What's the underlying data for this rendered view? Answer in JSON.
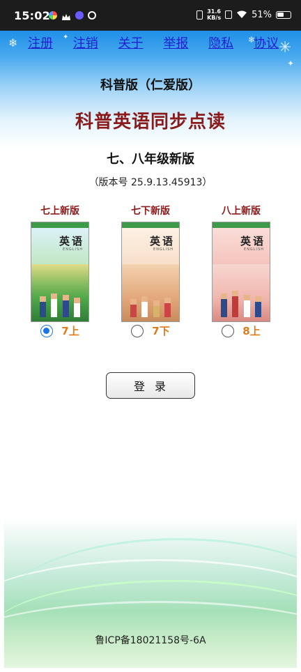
{
  "status_bar": {
    "time": "15:02",
    "speed": "31.6",
    "speed_unit": "KB/s",
    "battery": "51%"
  },
  "nav": {
    "items": [
      "注册",
      "注销",
      "关于",
      "举报",
      "隐私",
      "协议"
    ]
  },
  "header": {
    "edition": "科普版（仁爱版）",
    "title": "科普英语同步点读",
    "subtitle": "七、八年级新版",
    "version": "（版本号 25.9.13.45913）"
  },
  "books": [
    {
      "title": "七上新版",
      "cover_text": "英语",
      "cover_eng": "ENGLISH",
      "option": "7上",
      "selected": true
    },
    {
      "title": "七下新版",
      "cover_text": "英语",
      "cover_eng": "ENGLISH",
      "option": "7下",
      "selected": false
    },
    {
      "title": "八上新版",
      "cover_text": "英语",
      "cover_eng": "ENGLISH",
      "option": "8上",
      "selected": false
    }
  ],
  "login": {
    "label": "登录"
  },
  "footer": {
    "icp": "鲁ICP备18021158号-6A"
  },
  "colors": {
    "title": "#8b1a1a",
    "nav_link": "#1f1fcf",
    "radio_selected": "#1a73e8",
    "option_label": "#e07b1a"
  }
}
